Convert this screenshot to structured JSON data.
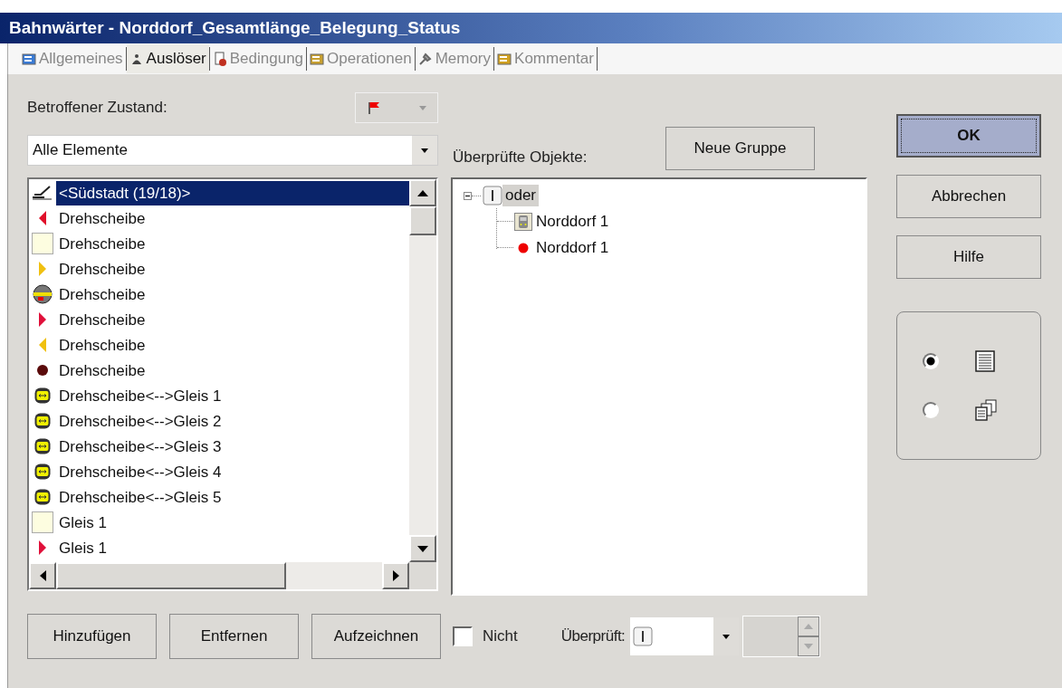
{
  "window": {
    "title": "Bahnwärter - Norddorf_Gesamtlänge_Belegung_Status"
  },
  "tabs": [
    {
      "label": "Allgemeines",
      "kind": "general",
      "selected": false
    },
    {
      "label": "Auslöser",
      "kind": "trigger",
      "selected": true
    },
    {
      "label": "Bedingung",
      "kind": "condition",
      "selected": false
    },
    {
      "label": "Operationen",
      "kind": "operations",
      "selected": false
    },
    {
      "label": "Memory",
      "kind": "memory",
      "selected": false
    },
    {
      "label": "Kommentar",
      "kind": "comment",
      "selected": false
    }
  ],
  "state_label": "Betroffener Zustand:",
  "state_combo": {
    "disabled": true
  },
  "filter_combo": {
    "value": "Alle Elemente"
  },
  "elements": [
    {
      "label": "<Südstadt (19/18)>",
      "kind": "pen",
      "selected": true
    },
    {
      "label": "Drehscheibe",
      "kind": "tri-left",
      "color": "#e0102a",
      "selected": false
    },
    {
      "label": "Drehscheibe",
      "kind": "square",
      "color": "#fdfde0",
      "selected": false
    },
    {
      "label": "Drehscheibe",
      "kind": "tri-right",
      "color": "#f0c010",
      "selected": false
    },
    {
      "label": "Drehscheibe",
      "kind": "disc",
      "color": "#f0e000",
      "selected": false
    },
    {
      "label": "Drehscheibe",
      "kind": "tri-right",
      "color": "#e0103a",
      "selected": false
    },
    {
      "label": "Drehscheibe",
      "kind": "tri-left",
      "color": "#f0c010",
      "selected": false
    },
    {
      "label": "Drehscheibe",
      "kind": "dot",
      "color": "#5a0a0a",
      "selected": false
    },
    {
      "label": "Drehscheibe<-->Gleis 1",
      "kind": "turntable",
      "color": "#f0f000",
      "selected": false
    },
    {
      "label": "Drehscheibe<-->Gleis 2",
      "kind": "turntable",
      "color": "#f0f000",
      "selected": false
    },
    {
      "label": "Drehscheibe<-->Gleis 3",
      "kind": "turntable",
      "color": "#f0f000",
      "selected": false
    },
    {
      "label": "Drehscheibe<-->Gleis 4",
      "kind": "turntable",
      "color": "#f0f000",
      "selected": false
    },
    {
      "label": "Drehscheibe<-->Gleis 5",
      "kind": "turntable",
      "color": "#f0f000",
      "selected": false
    },
    {
      "label": "Gleis 1",
      "kind": "square",
      "color": "#fdfde0",
      "selected": false
    },
    {
      "label": "Gleis 1",
      "kind": "tri-right",
      "color": "#e0103a",
      "selected": false
    }
  ],
  "checked_label": "Überprüfte Objekte:",
  "new_group_button": "Neue Gruppe",
  "tree": [
    {
      "label": "oder",
      "kind": "group",
      "expanded": true,
      "selected": true,
      "children": [
        {
          "label": "Norddorf 1",
          "kind": "train",
          "selected": false
        },
        {
          "label": "Norddorf 1",
          "kind": "dot",
          "selected": false
        }
      ]
    }
  ],
  "side_buttons": [
    {
      "label": "OK",
      "default": true
    },
    {
      "label": "Abbrechen",
      "default": false
    },
    {
      "label": "Hilfe",
      "default": false
    }
  ],
  "view_options": [
    {
      "kind": "list",
      "selected": true
    },
    {
      "kind": "pages",
      "selected": false
    }
  ],
  "bottom_buttons": [
    "Hinzufügen",
    "Entfernen",
    "Aufzeichnen"
  ],
  "not_checkbox": {
    "label": "Nicht",
    "checked": false
  },
  "checked_combo_label": "Überprüft:",
  "spin_field": {
    "disabled": true
  }
}
